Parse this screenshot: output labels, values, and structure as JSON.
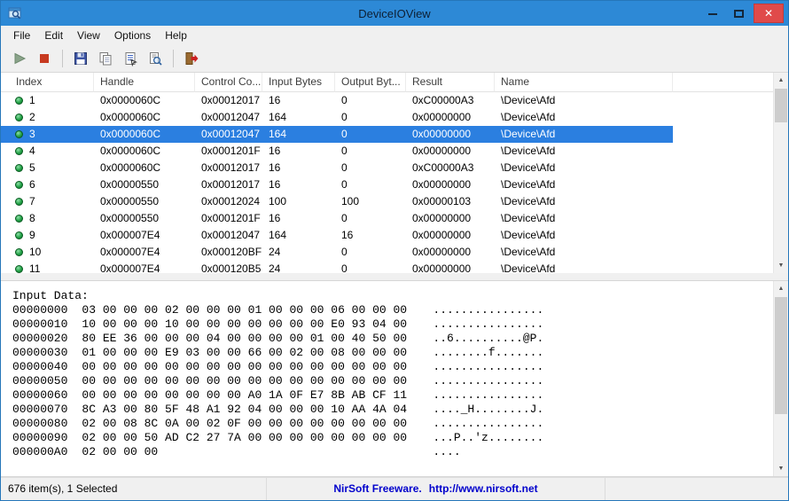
{
  "window": {
    "title": "DeviceIOView",
    "close_glyph": "✕"
  },
  "icons": {
    "scroll_up": "▲",
    "scroll_down": "▼"
  },
  "menu": {
    "items": [
      "File",
      "Edit",
      "View",
      "Options",
      "Help"
    ]
  },
  "toolbar": {
    "buttons": [
      {
        "name": "start-capture"
      },
      {
        "name": "stop-capture"
      },
      {
        "name": "save"
      },
      {
        "name": "copy"
      },
      {
        "name": "properties"
      },
      {
        "name": "find"
      },
      {
        "name": "exit"
      }
    ]
  },
  "table": {
    "columns": [
      "Index",
      "Handle",
      "Control Co...",
      "Input Bytes",
      "Output Byt...",
      "Result",
      "Name"
    ],
    "selected_index": 2,
    "rows": [
      {
        "index": "1",
        "handle": "0x0000060C",
        "control": "0x00012017",
        "input_bytes": "16",
        "output_bytes": "0",
        "result": "0xC00000A3",
        "name": "\\Device\\Afd"
      },
      {
        "index": "2",
        "handle": "0x0000060C",
        "control": "0x00012047",
        "input_bytes": "164",
        "output_bytes": "0",
        "result": "0x00000000",
        "name": "\\Device\\Afd"
      },
      {
        "index": "3",
        "handle": "0x0000060C",
        "control": "0x00012047",
        "input_bytes": "164",
        "output_bytes": "0",
        "result": "0x00000000",
        "name": "\\Device\\Afd"
      },
      {
        "index": "4",
        "handle": "0x0000060C",
        "control": "0x0001201F",
        "input_bytes": "16",
        "output_bytes": "0",
        "result": "0x00000000",
        "name": "\\Device\\Afd"
      },
      {
        "index": "5",
        "handle": "0x0000060C",
        "control": "0x00012017",
        "input_bytes": "16",
        "output_bytes": "0",
        "result": "0xC00000A3",
        "name": "\\Device\\Afd"
      },
      {
        "index": "6",
        "handle": "0x00000550",
        "control": "0x00012017",
        "input_bytes": "16",
        "output_bytes": "0",
        "result": "0x00000000",
        "name": "\\Device\\Afd"
      },
      {
        "index": "7",
        "handle": "0x00000550",
        "control": "0x00012024",
        "input_bytes": "100",
        "output_bytes": "100",
        "result": "0x00000103",
        "name": "\\Device\\Afd"
      },
      {
        "index": "8",
        "handle": "0x00000550",
        "control": "0x0001201F",
        "input_bytes": "16",
        "output_bytes": "0",
        "result": "0x00000000",
        "name": "\\Device\\Afd"
      },
      {
        "index": "9",
        "handle": "0x000007E4",
        "control": "0x00012047",
        "input_bytes": "164",
        "output_bytes": "16",
        "result": "0x00000000",
        "name": "\\Device\\Afd"
      },
      {
        "index": "10",
        "handle": "0x000007E4",
        "control": "0x000120BF",
        "input_bytes": "24",
        "output_bytes": "0",
        "result": "0x00000000",
        "name": "\\Device\\Afd"
      },
      {
        "index": "11",
        "handle": "0x000007E4",
        "control": "0x000120B5",
        "input_bytes": "24",
        "output_bytes": "0",
        "result": "0x00000000",
        "name": "\\Device\\Afd"
      }
    ]
  },
  "hex_viewer": {
    "title": "Input Data:",
    "lines": [
      {
        "offset": "00000000",
        "hex": "03 00 00 00 02 00 00 00 01 00 00 00 06 00 00 00",
        "ascii": "................"
      },
      {
        "offset": "00000010",
        "hex": "10 00 00 00 10 00 00 00 00 00 00 00 E0 93 04 00",
        "ascii": "................"
      },
      {
        "offset": "00000020",
        "hex": "80 EE 36 00 00 00 04 00 00 00 00 01 00 40 50 00",
        "ascii": "..6..........@P."
      },
      {
        "offset": "00000030",
        "hex": "01 00 00 00 E9 03 00 00 66 00 02 00 08 00 00 00",
        "ascii": "........f......."
      },
      {
        "offset": "00000040",
        "hex": "00 00 00 00 00 00 00 00 00 00 00 00 00 00 00 00",
        "ascii": "................"
      },
      {
        "offset": "00000050",
        "hex": "00 00 00 00 00 00 00 00 00 00 00 00 00 00 00 00",
        "ascii": "................"
      },
      {
        "offset": "00000060",
        "hex": "00 00 00 00 00 00 00 00 A0 1A 0F E7 8B AB CF 11",
        "ascii": "................"
      },
      {
        "offset": "00000070",
        "hex": "8C A3 00 80 5F 48 A1 92 04 00 00 00 10 AA 4A 04",
        "ascii": "...._H........J."
      },
      {
        "offset": "00000080",
        "hex": "02 00 08 8C 0A 00 02 0F 00 00 00 00 00 00 00 00",
        "ascii": "................"
      },
      {
        "offset": "00000090",
        "hex": "02 00 00 50 AD C2 27 7A 00 00 00 00 00 00 00 00",
        "ascii": "...P..'z........"
      },
      {
        "offset": "000000A0",
        "hex": "02 00 00 00",
        "ascii": "...."
      }
    ]
  },
  "status_bar": {
    "items_text": "676 item(s), 1 Selected",
    "freeware_text": "NirSoft Freeware.",
    "url": "http://www.nirsoft.net"
  },
  "colors": {
    "titlebar": "#2d89d6",
    "selection": "#2b7fe0",
    "link_blue": "#0000cc"
  }
}
